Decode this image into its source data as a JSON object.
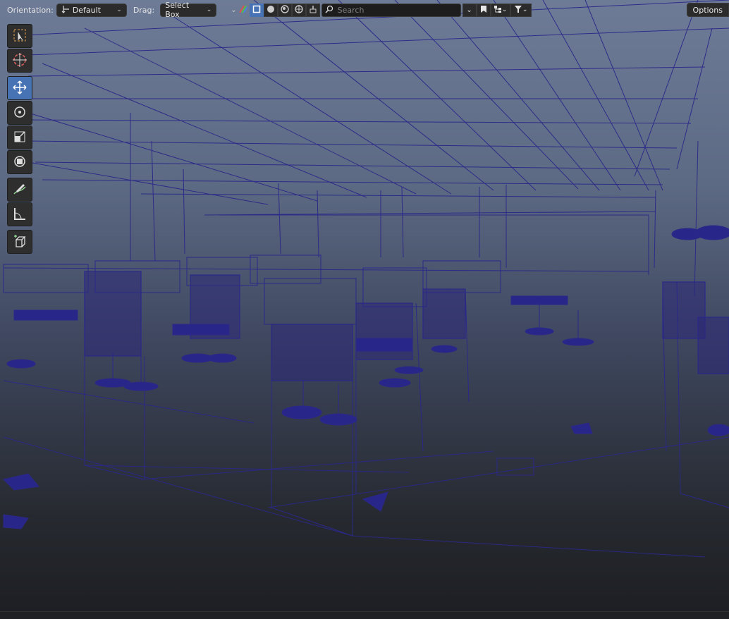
{
  "header": {
    "orientation_label": "Orientation:",
    "orientation_value": "Default",
    "drag_label": "Drag:",
    "drag_value": "Select Box",
    "search_placeholder": "Search",
    "options_label": "Options"
  },
  "toolbar": {
    "tools": [
      "select-box",
      "cursor",
      "move",
      "rotate",
      "scale",
      "transform",
      "annotate",
      "measure",
      "add-cube"
    ],
    "active_tool": "move"
  },
  "colors": {
    "wire": "#2d2a8a",
    "active": "#4772b3",
    "panel": "#2b2b2b"
  }
}
